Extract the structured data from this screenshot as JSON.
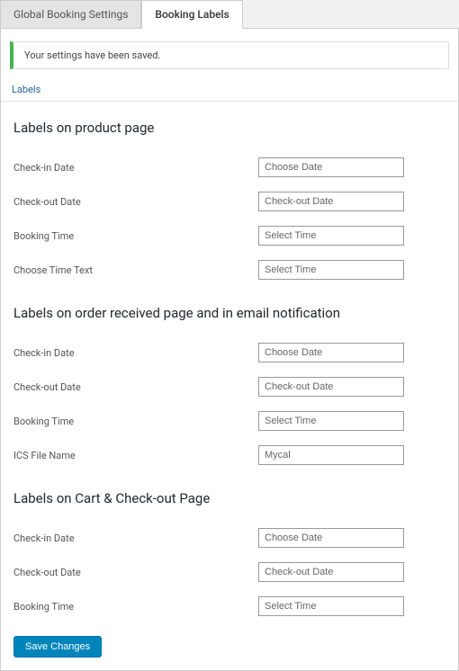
{
  "tabs": {
    "global": "Global Booking Settings",
    "labels": "Booking Labels"
  },
  "notice": "Your settings have been saved.",
  "panel_title": "Labels",
  "sections": {
    "product": {
      "title": "Labels on product page",
      "fields": {
        "check_in": {
          "label": "Check-in Date",
          "value": "Choose Date"
        },
        "check_out": {
          "label": "Check-out Date",
          "value": "Check-out Date"
        },
        "time": {
          "label": "Booking Time",
          "value": "Select Time"
        },
        "choose_time": {
          "label": "Choose Time Text",
          "value": "Select Time"
        }
      }
    },
    "order": {
      "title": "Labels on order received page and in email notification",
      "fields": {
        "check_in": {
          "label": "Check-in Date",
          "value": "Choose Date"
        },
        "check_out": {
          "label": "Check-out Date",
          "value": "Check-out Date"
        },
        "time": {
          "label": "Booking Time",
          "value": "Select Time"
        },
        "ics": {
          "label": "ICS File Name",
          "value": "Mycal"
        }
      }
    },
    "cart": {
      "title": "Labels on Cart & Check-out Page",
      "fields": {
        "check_in": {
          "label": "Check-in Date",
          "value": "Choose Date"
        },
        "check_out": {
          "label": "Check-out Date",
          "value": "Check-out Date"
        },
        "time": {
          "label": "Booking Time",
          "value": "Select Time"
        }
      }
    }
  },
  "save_button": "Save Changes"
}
